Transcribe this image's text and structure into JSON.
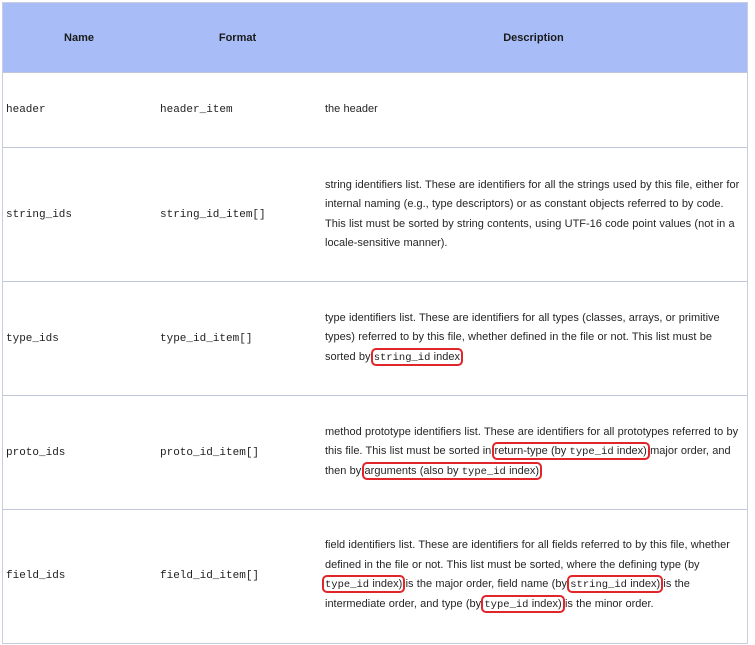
{
  "table": {
    "headers": {
      "name": "Name",
      "format": "Format",
      "description": "Description"
    },
    "rows": [
      {
        "name": "header",
        "format": "header_item",
        "description": [
          "the header"
        ]
      },
      {
        "name": "string_ids",
        "format": "string_id_item[]",
        "description": [
          "string identifiers list. These are identifiers for all the strings used by this file, either for internal naming (e.g., type descriptors) or as constant objects referred to by code. This list must be sorted by string contents, using UTF-16 code point values (not in a locale-sensitive manner)."
        ]
      },
      {
        "name": "type_ids",
        "format": "type_id_item[]",
        "description": [
          "type identifiers list. These are identifiers for all types (classes, arrays, or primitive types) referred to by this file, whether defined in the file or not. This list must be sorted by ",
          "string_id",
          " index",
          "."
        ]
      },
      {
        "name": "proto_ids",
        "format": "proto_id_item[]",
        "description": [
          "method prototype identifiers list. These are identifiers for all prototypes referred to by this file. This list must be sorted in ",
          "return-type (by ",
          "type_id",
          " index)",
          " major order, and then by ",
          "arguments (also by ",
          "type_id",
          " index)",
          "."
        ]
      },
      {
        "name": "field_ids",
        "format": "field_id_item[]",
        "description": [
          "field identifiers list. These are identifiers for all fields referred to by this file, whether defined in the file or not. This list must be sorted, where the defining type (by ",
          "type_id",
          " index)",
          " is the major order, field name (by ",
          "string_id",
          " index)",
          " is the intermediate order, and type (by ",
          "type_id",
          " index)",
          " is the minor order."
        ]
      }
    ]
  }
}
